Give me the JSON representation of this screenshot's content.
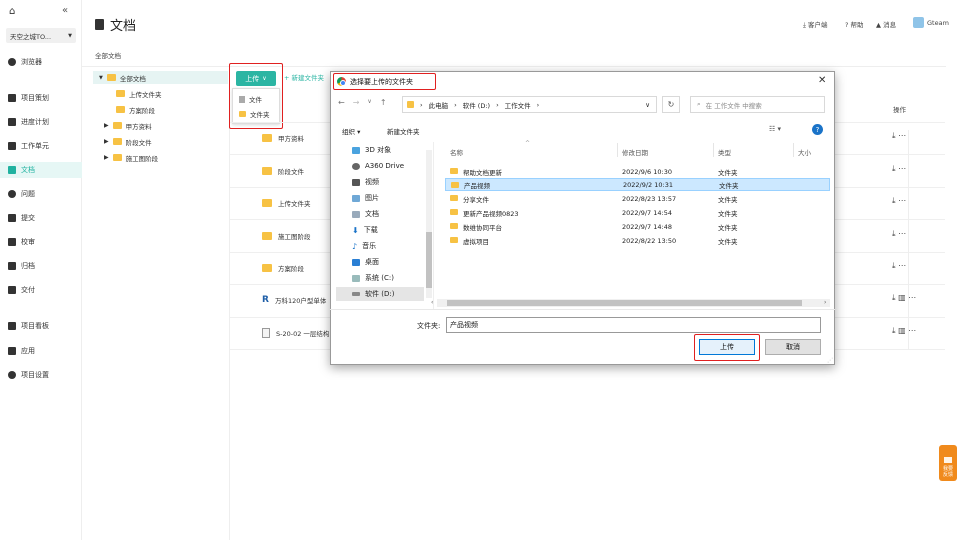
{
  "sidebar": {
    "project": "天空之城TO...",
    "items": [
      {
        "label": "浏览器",
        "icon": "globe-icon"
      },
      {
        "label": "项目策划",
        "icon": "flag-icon"
      },
      {
        "label": "进度计划",
        "icon": "progress-icon"
      },
      {
        "label": "工作单元",
        "icon": "cube-icon"
      },
      {
        "label": "文档",
        "icon": "document-icon",
        "active": true
      },
      {
        "label": "问题",
        "icon": "question-icon"
      },
      {
        "label": "提交",
        "icon": "submit-icon"
      },
      {
        "label": "校审",
        "icon": "review-icon"
      },
      {
        "label": "归档",
        "icon": "archive-icon"
      },
      {
        "label": "交付",
        "icon": "deliver-icon"
      },
      {
        "label": "项目看板",
        "icon": "dashboard-icon"
      },
      {
        "label": "应用",
        "icon": "apps-icon"
      },
      {
        "label": "项目设置",
        "icon": "settings-icon"
      }
    ]
  },
  "header": {
    "title": "文档",
    "client": "客户端",
    "help": "帮助",
    "messages": "消息",
    "user": "Gteam"
  },
  "breadcrumb": "全部文档",
  "tree": {
    "root": "全部文档",
    "children": [
      "上传文件夹",
      "方案阶段",
      "甲方资料",
      "阶段文件",
      "施工图阶段"
    ]
  },
  "toolbar": {
    "upload": "上传",
    "new_folder": "+ 新建文件夹"
  },
  "upload_menu": [
    "文件",
    "文件夹"
  ],
  "file_list": {
    "ops_header": "操作",
    "rows": [
      "甲方资料",
      "阶段文件",
      "上传文件夹",
      "施工图阶段",
      "方案阶段",
      "万科120户型单体",
      "S-20-02 一层结构"
    ]
  },
  "dialog": {
    "title": "选择要上传的文件夹",
    "address": [
      "此电脑",
      "软件 (D:)",
      "工作文件"
    ],
    "search_placeholder": "在 工作文件 中搜索",
    "organize": "组织 ▾",
    "new_folder": "新建文件夹",
    "nav_items": [
      "3D 对象",
      "A360 Drive",
      "视频",
      "图片",
      "文档",
      "下载",
      "音乐",
      "桌面",
      "系统 (C:)",
      "软件 (D:)"
    ],
    "columns": {
      "name": "名称",
      "date": "修改日期",
      "type": "类型",
      "size": "大小"
    },
    "files": [
      {
        "name": "帮助文档更新",
        "date": "2022/9/6 10:30",
        "type": "文件夹"
      },
      {
        "name": "产品视频",
        "date": "2022/9/2 10:31",
        "type": "文件夹",
        "selected": true
      },
      {
        "name": "分享文件",
        "date": "2022/8/23 13:57",
        "type": "文件夹"
      },
      {
        "name": "更新产品视频0823",
        "date": "2022/9/7 14:54",
        "type": "文件夹"
      },
      {
        "name": "数维协同平台",
        "date": "2022/9/7 14:48",
        "type": "文件夹"
      },
      {
        "name": "虚拟项目",
        "date": "2022/8/22 13:50",
        "type": "文件夹"
      }
    ],
    "folder_label": "文件夹:",
    "folder_value": "产品视频",
    "upload_button": "上传",
    "cancel_button": "取消"
  },
  "feedback": "我要反馈",
  "colors": {
    "accent": "#2bb5a3",
    "highlight": "#e02020",
    "folder": "#f7c244"
  }
}
